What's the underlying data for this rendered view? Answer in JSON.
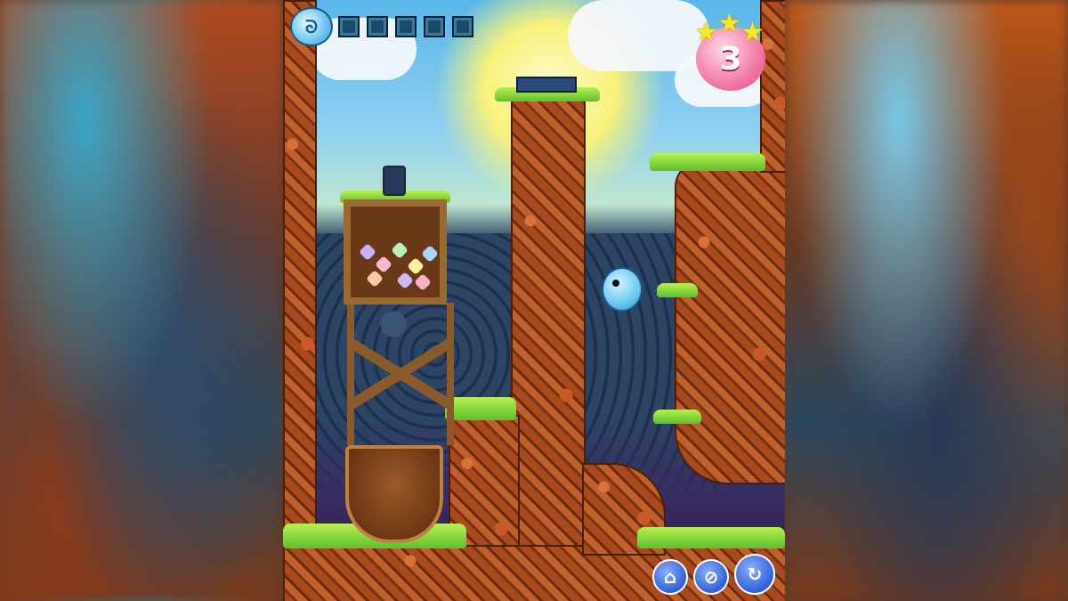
{
  "hud": {
    "logo_icon": "bird-logo-icon",
    "item_slots": [
      {
        "state": "empty"
      },
      {
        "state": "empty"
      },
      {
        "state": "empty"
      },
      {
        "state": "empty"
      },
      {
        "state": "empty"
      }
    ],
    "stars_earned": 3,
    "stars_total": 3,
    "star_color": "#f8ea1a",
    "level": "3",
    "level_badge_color": "#f06a9a"
  },
  "controls": {
    "home_icon": "home-icon",
    "sound_icon": "sound-muted-icon",
    "restart_icon": "restart-icon",
    "button_color": "#3060d8"
  },
  "scene": {
    "player": "blue-bird",
    "objects": [
      "wooden-tower",
      "gem-crate",
      "pot",
      "lantern",
      "switch-platform"
    ]
  }
}
